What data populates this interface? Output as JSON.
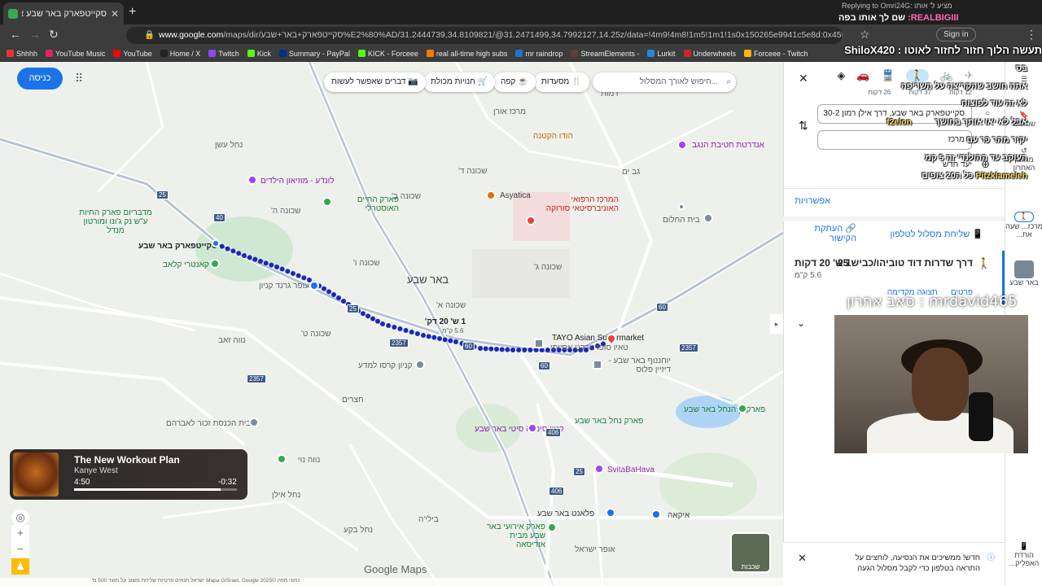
{
  "browser": {
    "tab_title": "סקייטפארק באר שבע אל מרכז",
    "url_domain": "www.google.com",
    "url_rest": "/maps/dir/סקייטפארק+באר+שבע%E2%80%AD/31.2444739,34.8109821/@31.2471499,34.7992127,14.25z/data=!4m9!4m8!1m5!1m1!1s0x150265e9941c5e8d:0x45f29cc67a9752ca!2m2!1d3",
    "signin": "Sign in",
    "bookmarks": [
      "Shhhh",
      "YouTube Music",
      "YouTube",
      "Home / X",
      "Twitch",
      "Kick",
      "Summary - PayPal",
      "KICK - Forceee",
      "real all-time high subs",
      "mr raindrop",
      "StreamElements -",
      "Lurkit",
      "Underwheels",
      "Forceee - Twitch"
    ]
  },
  "map": {
    "signin_button": "כניסה",
    "search_placeholder": "חיפוש לאורך המסלול...",
    "chips": [
      "מסעדות",
      "קפה",
      "חנויות מכולת",
      "דברים שאפשר לעשות"
    ],
    "labels": {
      "city": "באר שבע",
      "origin": "סקייטפארק באר שבע",
      "destination": "TAYO Asian Supermarket",
      "destination_he": "טאיו סופרמרקט אסייתי",
      "route_time": "1 ש' 20 דק'",
      "route_dist": "5.6 ק\"מ",
      "soroka": "המרכז הרפואי האוניברסיטאי סורוקה",
      "asyatica": "Asyatica",
      "hadar": "הודו הקטנה",
      "merkaz_oren": "מרכז אורן",
      "nahal_ashan": "נחל עשן",
      "lunda": "לונדע - מוזיאון הילדים",
      "park_hai": "פארק החיים האוסטרלי",
      "midbarium": "מדבריום פארק החיות ע\"ש נק ג'ונו ומורטון מנדל",
      "kantri": "קאנטרי קלאב",
      "ofer": "עופר גרנד קניון",
      "shchuna_d": "שכונה ד'",
      "shchuna_b": "שכונה ב'",
      "shchuna_g": "שכונה ג'",
      "shchuna_a": "שכונה א'",
      "shchuna_h": "שכונה ה'",
      "shchuna_t": "שכונה ט'",
      "shchuna_v": "שכונה ו'",
      "nave_zeev": "נווה זאב",
      "kanyon_kiryat": "קניון קרסו למדע",
      "vav": "ו'",
      "hatzerim": "חצרים",
      "beit_hakneset": "בית הכנסת זכור לאברהם",
      "nave_noy": "נווה נוי",
      "nahal_beka": "נחל בקע",
      "nahal_ailan": "נחל אילן",
      "biliya": "בילי'ה",
      "ramot": "רמות",
      "gan_ad": "גב ים",
      "beit_halomot": "בית החלום",
      "andarta": "אנדרטת חטיבת הנגב",
      "kanyon_sinema": "קניון סינמה סיטי באר שבע",
      "park_nahal": "פארק נחל באר שבע",
      "park_ayalim": "פארק גן הנחל באר שבע",
      "svita": "SvitaBaHava",
      "ikea": "איקאה",
      "palanet": "פלאנט באר שבע",
      "park_irua": "פארק אירועי באר שבע מבית אודיסאה",
      "yohanof": "יוחננוף באר שבע - דיזיין פלוס",
      "offer_israel": "אופר ישראל"
    },
    "road_numbers": [
      "25",
      "40",
      "25",
      "60",
      "2357",
      "2357",
      "60",
      "406",
      "406",
      "25",
      "60",
      "2357"
    ],
    "music": {
      "title": "The New Workout Plan",
      "artist": "Kanye West",
      "elapsed": "4:50",
      "remaining": "-0:32",
      "progress_fraction": 0.9
    },
    "layers_label": "שכבות",
    "brand": "Google Maps",
    "footer": "נתוני מפה ©2025 Mapa GISrael, Google  ישראל  תנאים  פרטיות  שליחת משוב על מוצר  500 מ'"
  },
  "panel": {
    "origin_field": "סקייטפארק באר שבע, דרך אילן רמון 30-2",
    "destination_field": "מרכז",
    "options": "אפשרויות",
    "send_to_phone": "שליחת מסלול לטלפון",
    "copy_link": "העתקת הקישור",
    "route_title": "דרך שדרות דוד טוביהו/כביש 25",
    "route_time": "1 ש' 20 דקות",
    "route_dist": "5.6 ק\"מ",
    "details": "פרטים",
    "preview": "תצוגה מקדימה",
    "notice": "חדש! ממשיכים את הנסיעה, לוחצים על התראה בטלפון כדי לקבל מסלול הגעה",
    "mode_times": [
      "12 דקות",
      "37 דקות",
      "26 דקות"
    ],
    "add_stop": "יעד חדש"
  },
  "rail": {
    "items": [
      "שמורים",
      "מהזמן האחרון",
      "מרכז... שעה את...",
      "באר שבע",
      "הורדת האפליק..."
    ]
  },
  "overlay": {
    "reply_header": "Replying to Omri24G: מציע ל' אותו",
    "reply_user": "REALBIGIII:",
    "reply_text": "שם לך אותו בפה",
    "pinned": "תעשה הלוך חזור לחזור לאוטו : ShiloX420",
    "lines": [
      {
        "user": "",
        "text": "בס"
      },
      {
        "user": "",
        "text": "אתה חושב שהקריצה על השריפה"
      },
      {
        "user": "",
        "text": "לא זה עוד לפוצוח"
      },
      {
        "user": "",
        "text": "אבל לא יאו אותך בחושך"
      },
      {
        "user": "f2elon",
        "text": ""
      },
      {
        "user": "",
        "text": "יקיר מהר כר עם"
      },
      {
        "user": "",
        "text": "העוקב עד ההולנדי זה 5 קמ"
      },
      {
        "user": "Pitzklameleh",
        "text": "כל ה20 צופים"
      }
    ],
    "stream_name": "mrdavid465 : סאב אחרון"
  }
}
